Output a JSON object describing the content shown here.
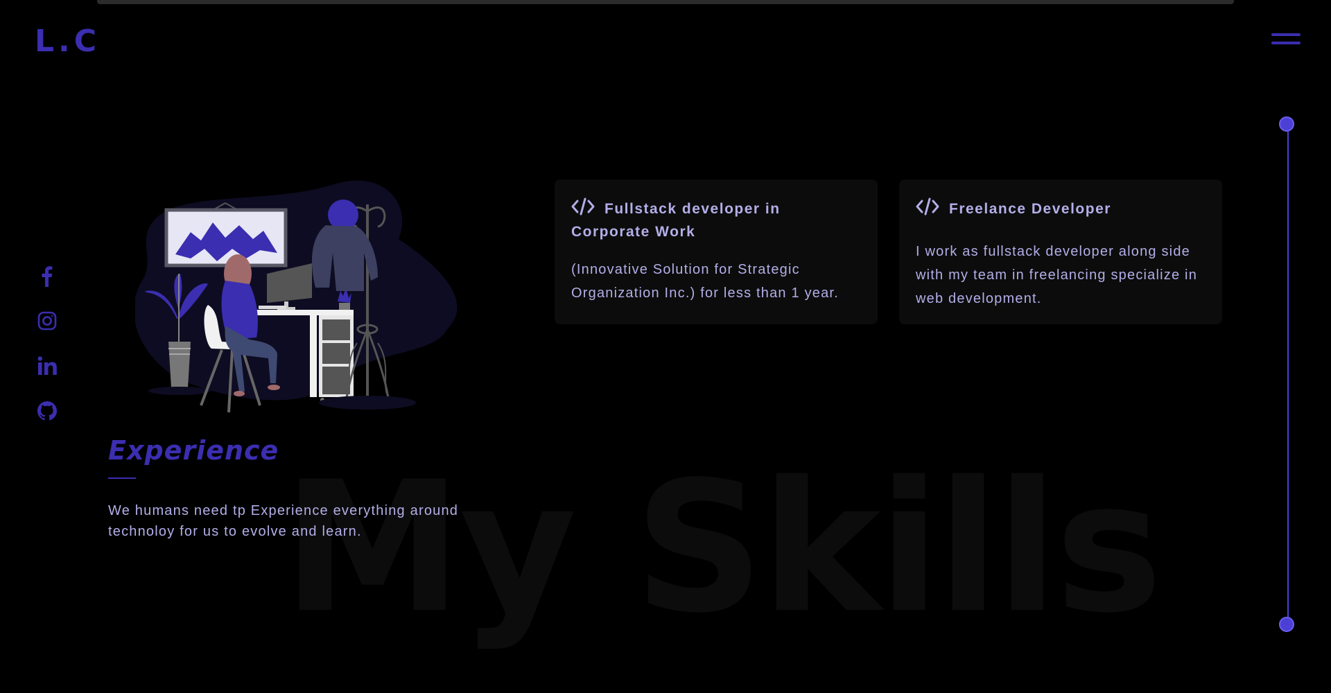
{
  "header": {
    "logo": "L.C"
  },
  "social": {
    "items": [
      "facebook",
      "instagram",
      "linkedin",
      "github"
    ]
  },
  "background_text": "My Skills",
  "experience": {
    "heading": "Experience",
    "description": "We humans need tp Experience everything around technoloy for us to evolve and learn."
  },
  "cards": [
    {
      "icon": "code-icon",
      "title": "Fullstack developer in Corporate Work",
      "body": "(Innovative Solution for Strategic Organization Inc.) for less than 1 year."
    },
    {
      "icon": "code-icon",
      "title": "Freelance Developer",
      "body": "I work as fullstack developer along side with my team in freelancing specialize in web development."
    }
  ],
  "colors": {
    "background": "#000000",
    "accent": "#3b2eb0",
    "text": "#b3aee8",
    "card": "#0c0c0c",
    "timeline": "#4b3fd6"
  }
}
